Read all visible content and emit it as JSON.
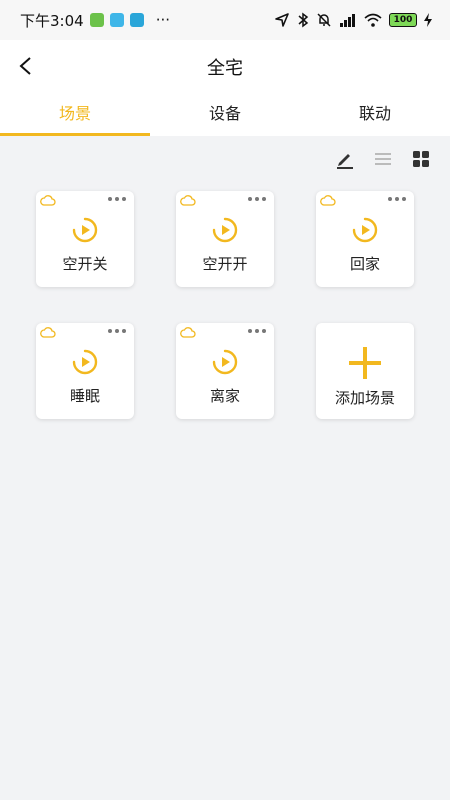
{
  "status_bar": {
    "time": "下午3:04",
    "more": "···",
    "battery": "100"
  },
  "header": {
    "title": "全宅"
  },
  "tabs": [
    {
      "label": "场景"
    },
    {
      "label": "设备"
    },
    {
      "label": "联动"
    }
  ],
  "toolbar": {
    "icons": [
      "edit-icon",
      "list-view-icon",
      "grid-view-icon"
    ]
  },
  "scenes": [
    {
      "label": "空开关"
    },
    {
      "label": "空开开"
    },
    {
      "label": "回家"
    },
    {
      "label": "睡眠"
    },
    {
      "label": "离家"
    }
  ],
  "add_scene": {
    "label": "添加场景"
  },
  "colors": {
    "accent": "#f2b81f",
    "background": "#f2f3f5",
    "card": "#ffffff"
  }
}
